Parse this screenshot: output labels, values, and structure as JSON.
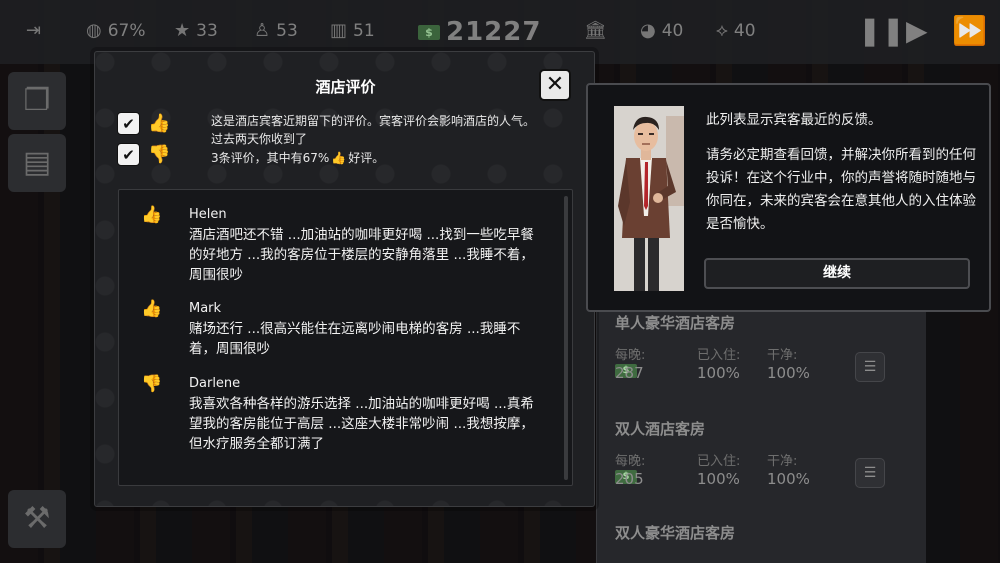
{
  "topbar": {
    "rating": "67%",
    "stars": "33",
    "guests": "53",
    "staff": "51",
    "money_icon": "$",
    "money": "21227",
    "bank_icon": "bank-icon",
    "pie_value": "40",
    "handshake_value": "40"
  },
  "room_panel": {
    "rooms": [
      {
        "title": "单人豪华酒店客房",
        "price_label": "每晚:",
        "occupancy_label": "已入住:",
        "clean_label": "干净:",
        "price": "287",
        "occupancy": "100%",
        "clean": "100%"
      },
      {
        "title": "双人酒店客房",
        "price_label": "每晚:",
        "occupancy_label": "已入住:",
        "clean_label": "干净:",
        "price": "205",
        "occupancy": "100%",
        "clean": "100%"
      },
      {
        "title": "双人豪华酒店客房"
      }
    ]
  },
  "dialog": {
    "title": "酒店评价",
    "close_label": "✕",
    "intro_line1": "这是酒店宾客近期留下的评价。宾客评价会影响酒店的人气。",
    "intro_line2": "过去两天你收到了",
    "intro_line3a": "3条评价，其中有67%",
    "intro_line3b": "好评。",
    "filters": [
      {
        "checked": true,
        "type": "positive"
      },
      {
        "checked": true,
        "type": "negative"
      }
    ],
    "reviews": [
      {
        "name": "Helen",
        "sentiment": "positive",
        "text": "酒店酒吧还不错 ...加油站的咖啡更好喝 ...找到一些吃早餐的好地方 ...我的客房位于楼层的安静角落里 ...我睡不着，周围很吵"
      },
      {
        "name": "Mark",
        "sentiment": "positive",
        "text": "赌场还行 ...很高兴能住在远离吵闹电梯的客房 ...我睡不着，周围很吵"
      },
      {
        "name": "Darlene",
        "sentiment": "negative",
        "text": "我喜欢各种各样的游乐选择 ...加油站的咖啡更好喝 ...真希望我的客房能位于高层 ...这座大楼非常吵闹 ...我想按摩，但水疗服务全都订满了"
      }
    ]
  },
  "advisor": {
    "line1": "此列表显示宾客最近的反馈。",
    "line2": "请务必定期查看回馈，并解决你所看到的任何投诉！在这个行业中，你的声誉将随时随地与你同在，未来的宾客会在意其他人的入住体验是否愉快。",
    "continue_label": "继续"
  },
  "colors": {
    "positive": "#7ed13b",
    "negative": "#e0392c",
    "money_green": "#3f6b40"
  }
}
